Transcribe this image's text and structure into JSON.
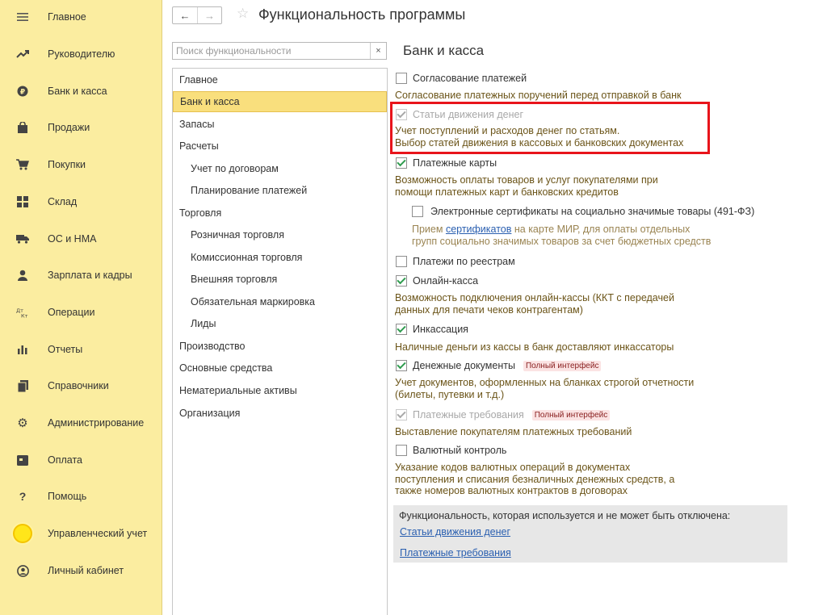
{
  "sidebar": {
    "items": [
      {
        "label": "Главное",
        "icon": "menu-icon"
      },
      {
        "label": "Руководителю",
        "icon": "trend-icon"
      },
      {
        "label": "Банк и касса",
        "icon": "coin-icon"
      },
      {
        "label": "Продажи",
        "icon": "bag-icon"
      },
      {
        "label": "Покупки",
        "icon": "cart-icon"
      },
      {
        "label": "Склад",
        "icon": "grid-icon"
      },
      {
        "label": "ОС и НМА",
        "icon": "truck-icon"
      },
      {
        "label": "Зарплата и кадры",
        "icon": "person-icon"
      },
      {
        "label": "Операции",
        "icon": "dt-kt-icon"
      },
      {
        "label": "Отчеты",
        "icon": "bar-chart-icon"
      },
      {
        "label": "Справочники",
        "icon": "books-icon"
      },
      {
        "label": "Администрирование",
        "icon": "gear-icon"
      },
      {
        "label": "Оплата",
        "icon": "wallet-icon"
      },
      {
        "label": "Помощь",
        "icon": "question-icon"
      },
      {
        "label": "Управленческий учет",
        "icon": "sun-icon"
      },
      {
        "label": "Личный кабинет",
        "icon": "account-icon"
      }
    ]
  },
  "header": {
    "back": "←",
    "forward": "→",
    "star": "☆",
    "title": "Функциональность программы"
  },
  "search": {
    "placeholder": "Поиск функциональности",
    "clear": "×"
  },
  "sections": [
    {
      "label": "Главное",
      "level": 0
    },
    {
      "label": "Банк и касса",
      "level": 0,
      "active": true
    },
    {
      "label": "Запасы",
      "level": 0
    },
    {
      "label": "Расчеты",
      "level": 0
    },
    {
      "label": "Учет по договорам",
      "level": 1
    },
    {
      "label": "Планирование платежей",
      "level": 1
    },
    {
      "label": "Торговля",
      "level": 0
    },
    {
      "label": "Розничная торговля",
      "level": 1
    },
    {
      "label": "Комиссионная торговля",
      "level": 1
    },
    {
      "label": "Внешняя торговля",
      "level": 1
    },
    {
      "label": "Обязательная маркировка",
      "level": 1
    },
    {
      "label": "Лиды",
      "level": 1
    },
    {
      "label": "Производство",
      "level": 0
    },
    {
      "label": "Основные средства",
      "level": 0
    },
    {
      "label": "Нематериальные активы",
      "level": 0
    },
    {
      "label": "Организация",
      "level": 0
    }
  ],
  "content": {
    "title": "Банк и касса",
    "badge": "Полный интерфейс",
    "options": {
      "soglas": {
        "label": "Согласование платежей",
        "checked": false,
        "desc": "Согласование платежных поручений перед отправкой в банк"
      },
      "stati": {
        "label": "Статьи движения денег",
        "checked": true,
        "disabled": true,
        "desc1": "Учет поступлений и расходов денег по статьям.",
        "desc2": "Выбор статей движения в кассовых и банковских документах"
      },
      "karty": {
        "label": "Платежные карты",
        "checked": true,
        "desc1": "Возможность оплаты товаров и услуг покупателями при",
        "desc2": "помощи платежных карт и банковских кредитов"
      },
      "sert": {
        "label": "Электронные сертификаты на социально значимые товары (491-ФЗ)",
        "checked": false,
        "desc_pre": "Прием ",
        "desc_link": "сертификатов",
        "desc_post": " на карте МИР, для оплаты отдельных",
        "desc2": "групп социально значимых товаров за счет бюджетных средств"
      },
      "reestr": {
        "label": "Платежи по реестрам",
        "checked": false
      },
      "kassa": {
        "label": "Онлайн-касса",
        "checked": true,
        "desc1": "Возможность подключения онлайн-кассы (ККТ с передачей",
        "desc2": "данных для печати чеков контрагентам)"
      },
      "inkass": {
        "label": "Инкассация",
        "checked": true,
        "desc": "Наличные деньги из кассы в банк доставляют инкассаторы"
      },
      "dendoc": {
        "label": "Денежные документы",
        "checked": true,
        "desc1": "Учет документов, оформленных на бланках строгой отчетности",
        "desc2": "(билеты, путевки и т.д.)"
      },
      "treb": {
        "label": "Платежные требования",
        "checked": true,
        "disabled": true,
        "desc": "Выставление покупателям платежных требований"
      },
      "valut": {
        "label": "Валютный контроль",
        "checked": false,
        "desc1": "Указание кодов валютных операций в документах",
        "desc2": "поступления и списания безналичных денежных средств, а",
        "desc3": "также номеров валютных контрактов в договорах"
      }
    },
    "fixed": {
      "title": "Функциональность, которая используется и не может быть отключена:",
      "links": [
        "Статьи движения денег",
        "Платежные требования"
      ]
    }
  },
  "colors": {
    "sidebar_bg": "#fbeda0",
    "active_section": "#f9df7d",
    "highlight_box": "#e8141b",
    "check": "#2e9b4e",
    "desc_text": "#6b5418",
    "link": "#2a5fb0"
  }
}
